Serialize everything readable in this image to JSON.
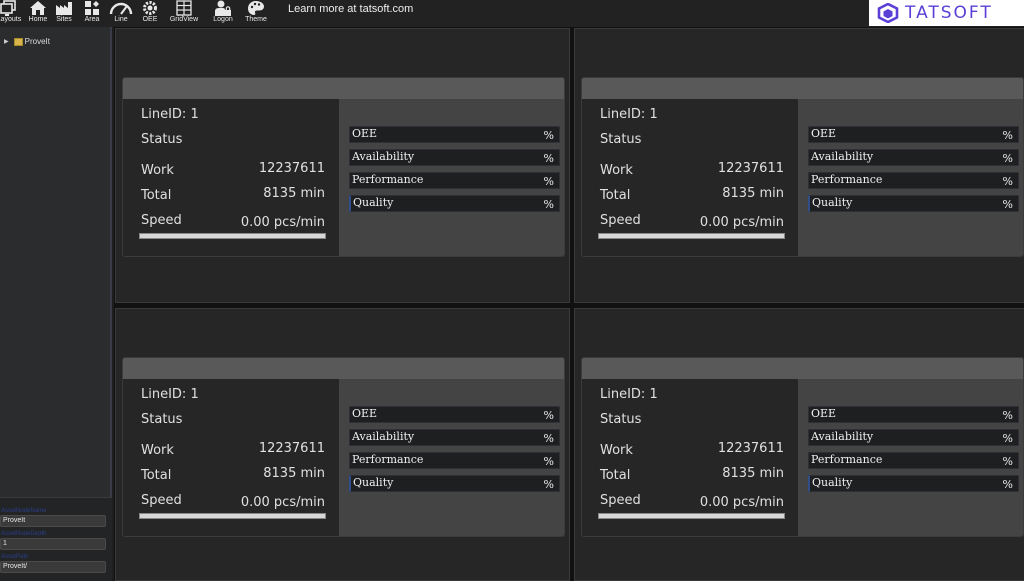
{
  "toolbar": {
    "buttons": [
      {
        "label": "Layouts",
        "icon": "layouts-icon"
      },
      {
        "label": "Home",
        "icon": "home-icon"
      },
      {
        "label": "Sites",
        "icon": "factory-icon"
      },
      {
        "label": "Area",
        "icon": "area-icon"
      },
      {
        "label": "Line",
        "icon": "gauge-icon"
      },
      {
        "label": "OEE",
        "icon": "gear-icon"
      },
      {
        "label": "GridView",
        "icon": "grid-icon"
      },
      {
        "label": "Logon",
        "icon": "user-lock-icon"
      },
      {
        "label": "Theme",
        "icon": "palette-icon"
      }
    ],
    "learn_more": "Learn more at tatsoft.com",
    "logo_text": "TATSOFT",
    "brand_color": "#5b3fd6"
  },
  "sidebar": {
    "tree": [
      {
        "label": "ProveIt",
        "expanded": false
      }
    ],
    "properties": [
      {
        "label": "AssetNodeName",
        "value": "ProveIt"
      },
      {
        "label": "AssetNodeDepth",
        "value": "1"
      },
      {
        "label": "AssetPath",
        "value": "ProveIt/"
      }
    ]
  },
  "panels": [
    {
      "line_id": "LineID: 1",
      "status_label": "Status",
      "work_label": "Work",
      "work_value": "12237611",
      "total_label": "Total",
      "total_value": "8135 min",
      "speed_label": "Speed",
      "speed_value": "0.00 pcs/min",
      "kpis": [
        {
          "label": "OEE",
          "value": "%"
        },
        {
          "label": "Availability",
          "value": "%"
        },
        {
          "label": "Performance",
          "value": "%"
        },
        {
          "label": "Quality",
          "value": "%"
        }
      ]
    },
    {
      "line_id": "LineID: 1",
      "status_label": "Status",
      "work_label": "Work",
      "work_value": "12237611",
      "total_label": "Total",
      "total_value": "8135 min",
      "speed_label": "Speed",
      "speed_value": "0.00 pcs/min",
      "kpis": [
        {
          "label": "OEE",
          "value": "%"
        },
        {
          "label": "Availability",
          "value": "%"
        },
        {
          "label": "Performance",
          "value": "%"
        },
        {
          "label": "Quality",
          "value": "%"
        }
      ]
    },
    {
      "line_id": "LineID: 1",
      "status_label": "Status",
      "work_label": "Work",
      "work_value": "12237611",
      "total_label": "Total",
      "total_value": "8135 min",
      "speed_label": "Speed",
      "speed_value": "0.00 pcs/min",
      "kpis": [
        {
          "label": "OEE",
          "value": "%"
        },
        {
          "label": "Availability",
          "value": "%"
        },
        {
          "label": "Performance",
          "value": "%"
        },
        {
          "label": "Quality",
          "value": "%"
        }
      ]
    },
    {
      "line_id": "LineID: 1",
      "status_label": "Status",
      "work_label": "Work",
      "work_value": "12237611",
      "total_label": "Total",
      "total_value": "8135 min",
      "speed_label": "Speed",
      "speed_value": "0.00 pcs/min",
      "kpis": [
        {
          "label": "OEE",
          "value": "%"
        },
        {
          "label": "Availability",
          "value": "%"
        },
        {
          "label": "Performance",
          "value": "%"
        },
        {
          "label": "Quality",
          "value": "%"
        }
      ]
    }
  ]
}
